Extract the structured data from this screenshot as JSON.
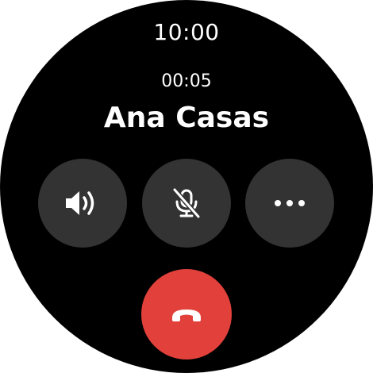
{
  "status_bar": {
    "time": "10:00"
  },
  "call": {
    "duration": "00:05",
    "caller_name": "Ana Casas"
  },
  "controls": [
    {
      "name": "speaker",
      "icon": "speaker-volume-icon"
    },
    {
      "name": "mute",
      "icon": "microphone-off-icon"
    },
    {
      "name": "more",
      "icon": "more-horizontal-icon"
    }
  ],
  "end_call": {
    "icon": "phone-hangup-icon",
    "color": "#e2413b"
  },
  "colors": {
    "background": "#000000",
    "button": "#333334",
    "text": "#ffffff",
    "end_call": "#e2413b"
  }
}
